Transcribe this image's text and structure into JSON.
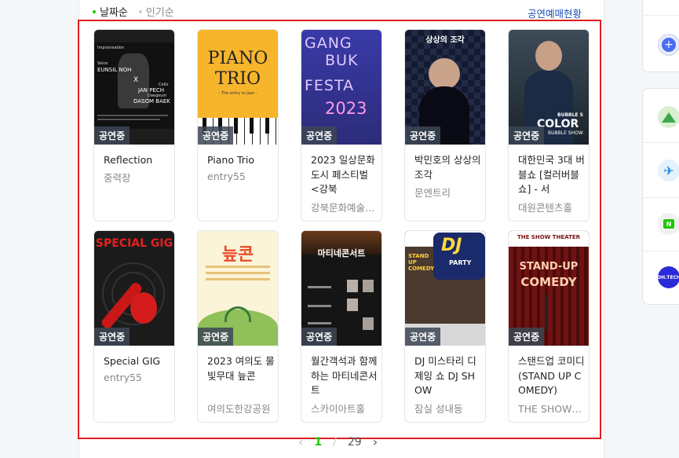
{
  "sort": {
    "tabs": [
      {
        "label": "날짜순",
        "active": true
      },
      {
        "label": "인기순",
        "active": false
      }
    ]
  },
  "status_link": "공연예매현황",
  "badge_label": "공연중",
  "cards": [
    {
      "title": "Reflection",
      "venue": "중력장"
    },
    {
      "title": "Piano Trio",
      "venue": "entry55"
    },
    {
      "title": "2023 일상문화도시 페스티벌 <강북",
      "venue": "강북문화예술회관"
    },
    {
      "title": "박민호의 상상의 조각",
      "venue": "문엔트리"
    },
    {
      "title": "대한민국 3대 버블쇼 [컬러버블쇼] - 서",
      "venue": "대원콘텐츠홀"
    },
    {
      "title": "Special GIG",
      "venue": "entry55"
    },
    {
      "title": "2023 여의도 물빛무대 늪콘",
      "venue": "여의도한강공원"
    },
    {
      "title": "월간객석과 함께하는 마티네콘서트",
      "venue": "스카이아트홀"
    },
    {
      "title": "DJ 미스타리 디제잉 쇼 DJ SHOW",
      "venue": "잠실 성내동"
    },
    {
      "title": "스탠드업 코미디 (STAND UP COMEDY)",
      "venue": "THE SHOW 시어터"
    }
  ],
  "posters": {
    "p1": {
      "line1": "Improvisation",
      "line2": "Voice",
      "line3": "EUNSIL NOH",
      "line4": "X",
      "line5": "Cello",
      "line6": "JAN PECH",
      "line7": "Daegeum",
      "line8": "DASOM BAEK"
    },
    "p2": {
      "line1": "PIANO",
      "line2": "TRIO",
      "line3": "- The entry to Jazz -"
    },
    "p3": {
      "line1": "GANG",
      "line2": "BUK",
      "line3": "FESTA",
      "line4": "2023"
    },
    "p4": {
      "line1": "상상의 조각"
    },
    "p5": {
      "line1": "BUBBLE S",
      "line2": "COLOR",
      "line3": "BUBBLE SHOW"
    },
    "p6": {
      "line1": "SPECIAL GIG"
    },
    "p7": {
      "line1": "늪콘"
    },
    "p8": {
      "line1": "마티네콘서트"
    },
    "p9": {
      "line1": "DJ",
      "line2": "PARTY",
      "line3": "STAND UP COMEDY"
    },
    "p10": {
      "line1": "THE SHOW  THEATER",
      "line2": "STAND-UP",
      "line3": "COMEDY"
    }
  },
  "pagination": {
    "current": "1",
    "separator": "/",
    "total": "29"
  },
  "right_panel": {
    "icons": [
      "plus-icon",
      "mountain-icon",
      "airplane-icon",
      "naver-app-icon",
      "ohtech-icon"
    ],
    "ohtech_label": "OH.TECH"
  }
}
